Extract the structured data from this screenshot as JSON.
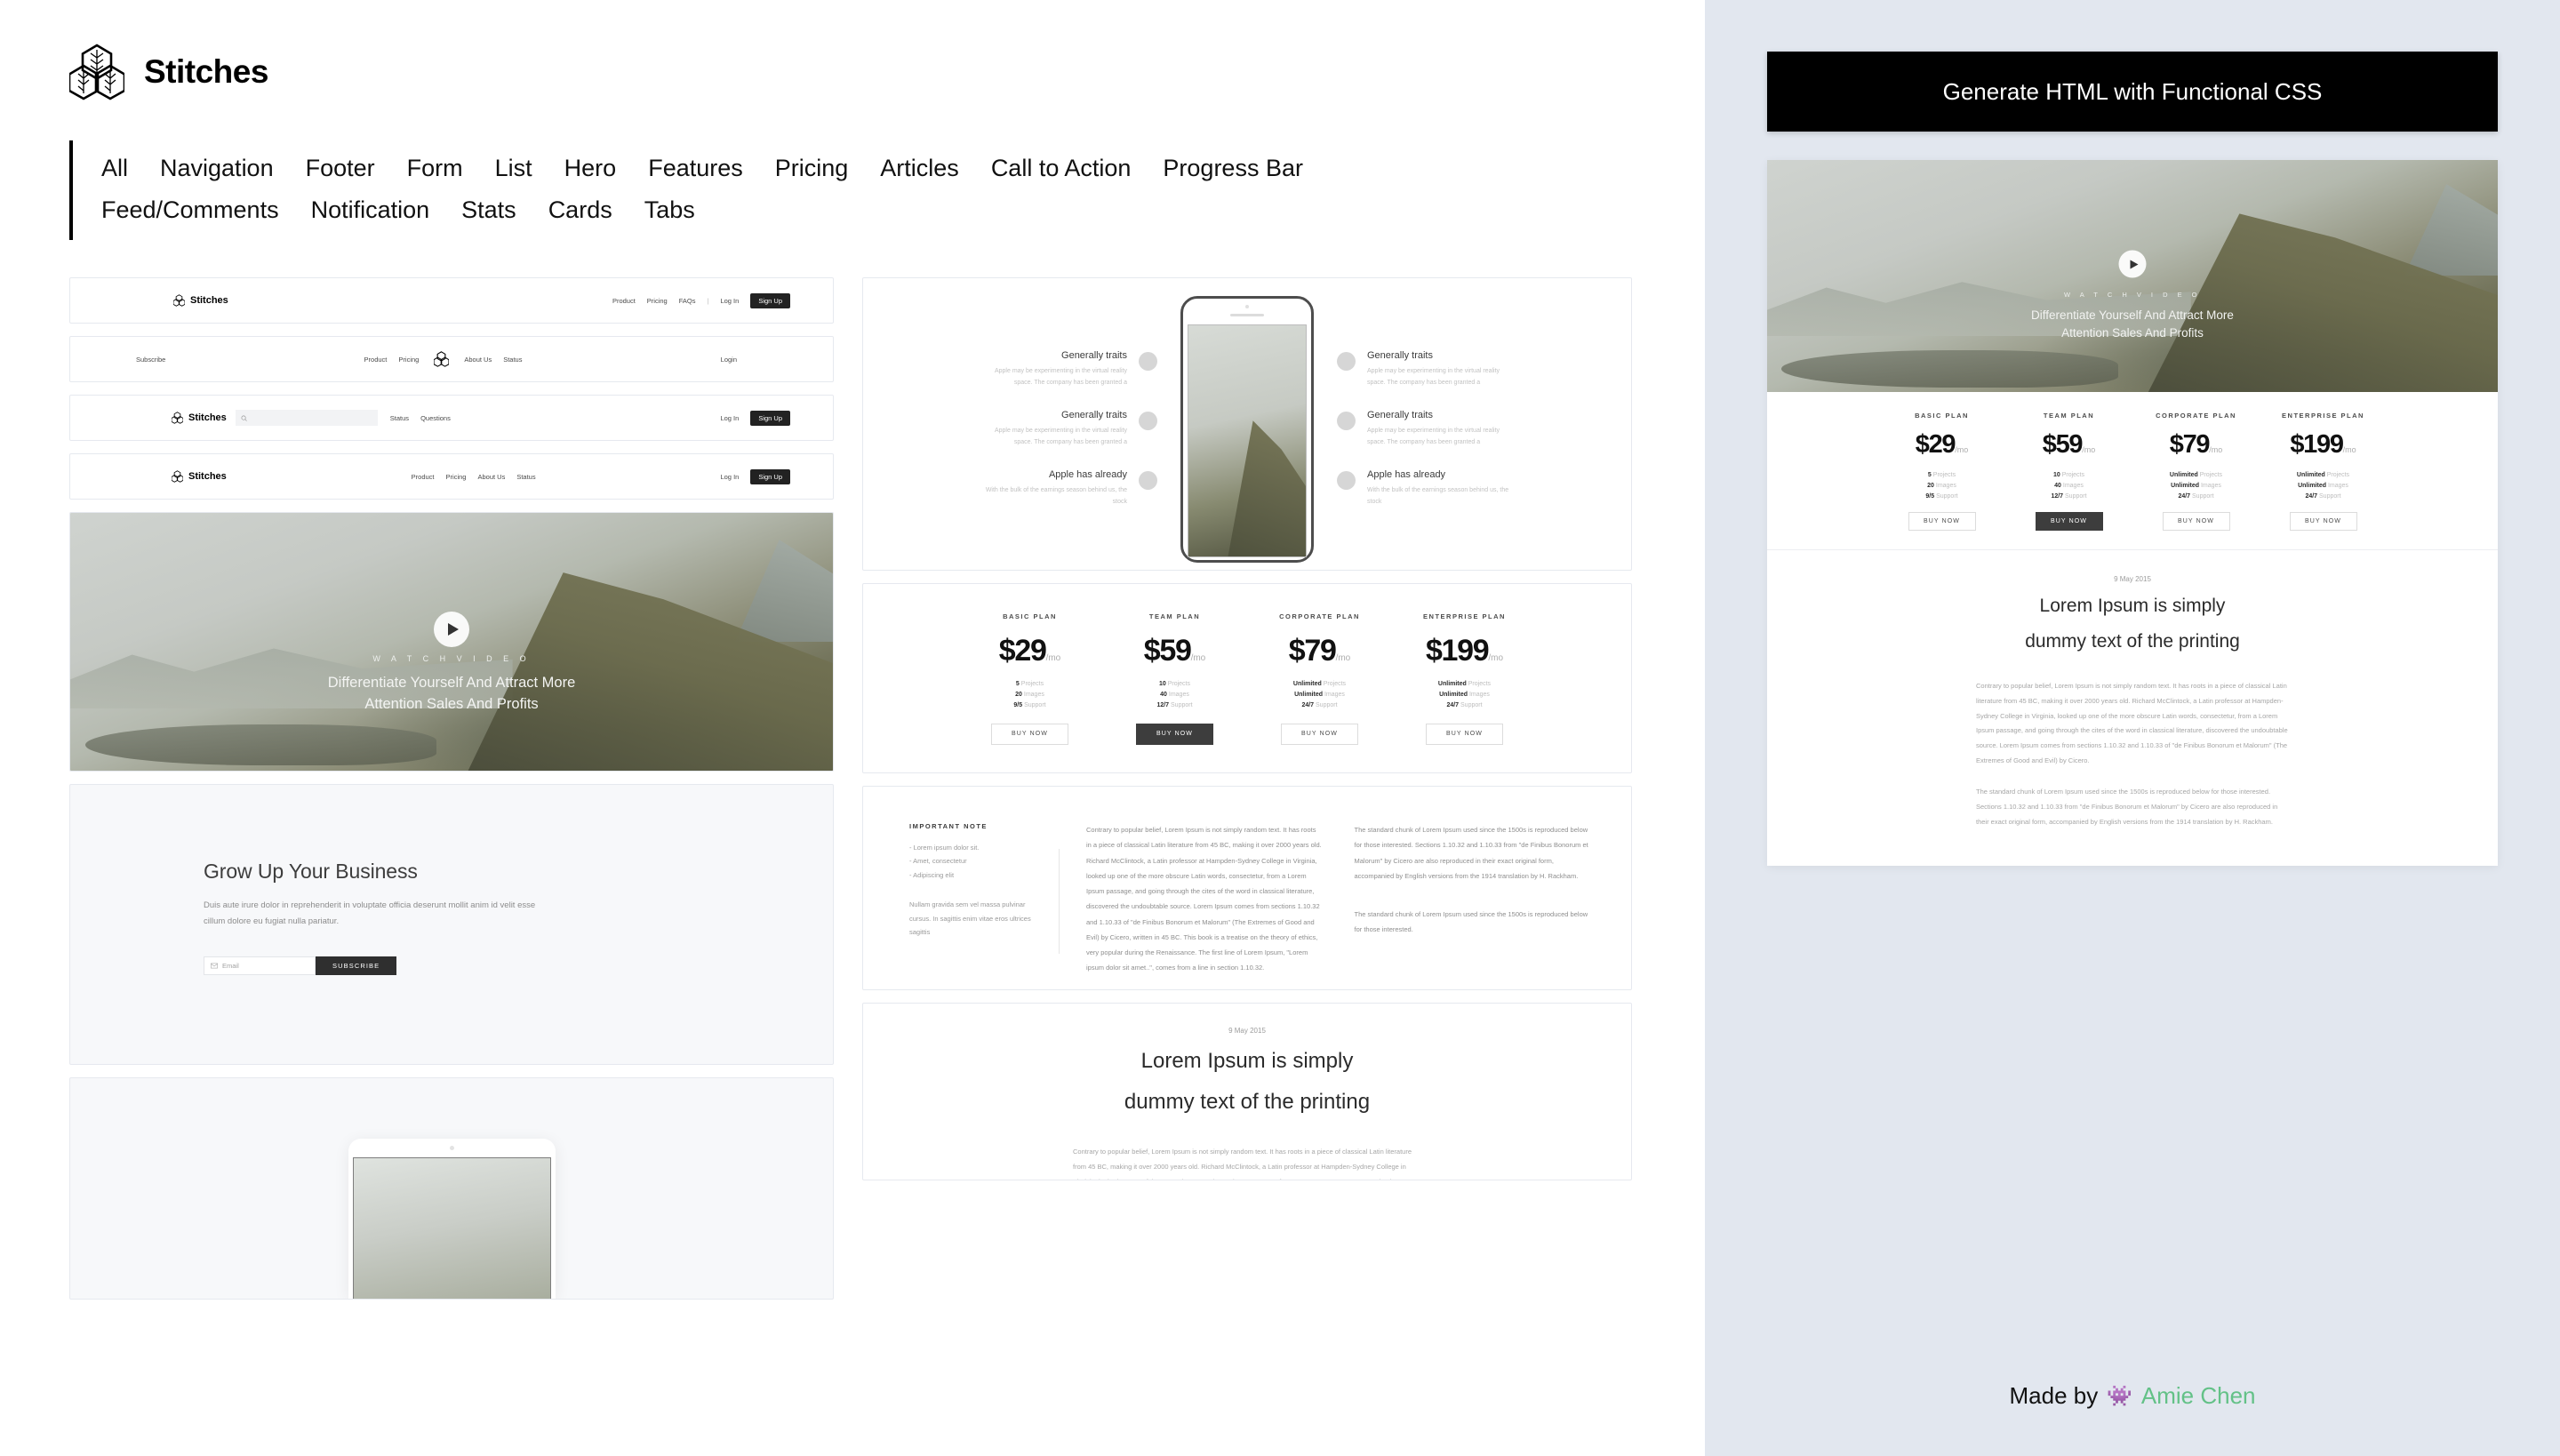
{
  "brand": {
    "name": "Stitches",
    "logo_icon": "stitches-cube-logo"
  },
  "filters": [
    "All",
    "Navigation",
    "Footer",
    "Form",
    "List",
    "Hero",
    "Features",
    "Pricing",
    "Articles",
    "Call to Action",
    "Progress Bar",
    "Feed/Comments",
    "Notification",
    "Stats",
    "Cards",
    "Tabs"
  ],
  "navbars": [
    {
      "logo": "Stitches",
      "links": [
        "Product",
        "Pricing",
        "FAQs"
      ],
      "divider": "|",
      "login": "Log In",
      "signup": "Sign Up",
      "has_search": false,
      "variant": "logo-left"
    },
    {
      "subscribe": "Subscribe",
      "links": [
        "Product",
        "Pricing"
      ],
      "links_right": [
        "About Us",
        "Status"
      ],
      "login": "Login",
      "variant": "center-logo"
    },
    {
      "logo": "Stitches",
      "search_placeholder": "",
      "search_icon": "search-icon",
      "links": [
        "Status",
        "Questions"
      ],
      "login": "Log In",
      "signup": "Sign Up",
      "has_search": true,
      "variant": "with-search"
    },
    {
      "logo": "Stitches",
      "links": [
        "Product",
        "Pricing",
        "About Us",
        "Status"
      ],
      "login": "Log In",
      "signup": "Sign Up",
      "has_search": false,
      "variant": "links-center"
    }
  ],
  "hero": {
    "kicker": "W A T C H   V I D E O",
    "title_line1": "Differentiate Yourself And Attract More",
    "title_line2": "Attention Sales And Profits",
    "play_icon": "play-icon"
  },
  "cta": {
    "heading": "Grow Up Your Business",
    "body": "Duis aute irure dolor in reprehenderit in voluptate officia deserunt mollit anim id velit esse cillum dolore eu fugiat nulla pariatur.",
    "email_placeholder": "Email",
    "email_icon": "envelope-icon",
    "subscribe_label": "SUBSCRIBE"
  },
  "features": {
    "left": [
      {
        "title": "Generally traits",
        "body": "Apple may be experimenting in the virtual reality space. The company has been granted a"
      },
      {
        "title": "Generally traits",
        "body": "Apple may be experimenting in the virtual reality space. The company has been granted a"
      },
      {
        "title": "Apple has already",
        "body": "With the bulk of the earnings season behind us, the stock"
      }
    ],
    "right": [
      {
        "title": "Generally traits",
        "body": "Apple may be experimenting in the virtual reality space. The company has been granted a"
      },
      {
        "title": "Generally traits",
        "body": "Apple may be experimenting in the virtual reality space. The company has been granted a"
      },
      {
        "title": "Apple has already",
        "body": "With the bulk of the earnings season behind us, the stock"
      }
    ]
  },
  "pricing": {
    "plans": [
      {
        "name": "BASIC PLAN",
        "price": "$29",
        "per": "/mo",
        "features": [
          {
            "value": "5",
            "label": "Projects"
          },
          {
            "value": "20",
            "label": "Images"
          },
          {
            "value": "9/5",
            "label": "Support"
          }
        ],
        "button": "BUY NOW",
        "highlighted": false
      },
      {
        "name": "TEAM PLAN",
        "price": "$59",
        "per": "/mo",
        "features": [
          {
            "value": "10",
            "label": "Projects"
          },
          {
            "value": "40",
            "label": "Images"
          },
          {
            "value": "12/7",
            "label": "Support"
          }
        ],
        "button": "BUY NOW",
        "highlighted": true
      },
      {
        "name": "CORPORATE PLAN",
        "price": "$79",
        "per": "/mo",
        "features": [
          {
            "value": "Unlimited",
            "label": "Projects"
          },
          {
            "value": "Unlimited",
            "label": "Images"
          },
          {
            "value": "24/7",
            "label": "Support"
          }
        ],
        "button": "BUY NOW",
        "highlighted": false
      },
      {
        "name": "ENTERPRISE PLAN",
        "price": "$199",
        "per": "/mo",
        "features": [
          {
            "value": "Unlimited",
            "label": "Projects"
          },
          {
            "value": "Unlimited",
            "label": "Images"
          },
          {
            "value": "24/7",
            "label": "Support"
          }
        ],
        "button": "BUY NOW",
        "highlighted": false
      }
    ]
  },
  "article": {
    "note_heading": "IMPORTANT NOTE",
    "note_items": [
      "- Lorem ipsum dolor sit.",
      "- Amet, consectetur",
      "- Adipiscing elit"
    ],
    "note_paragraph": "Nullam gravida sem vel massa pulvinar cursus. In sagittis enim vitae eros ultrices sagittis",
    "col1": "Contrary to popular belief, Lorem Ipsum is not simply random text. It has roots in a piece of classical Latin literature from 45 BC, making it over 2000 years old. Richard McClintock, a Latin professor at Hampden-Sydney College in Virginia, looked up one of the more obscure Latin words, consectetur, from a Lorem Ipsum passage, and going through the cites of the word in classical literature, discovered the undoubtable source. Lorem Ipsum comes from sections 1.10.32 and 1.10.33 of \"de Finibus Bonorum et Malorum\" (The Extremes of Good and Evil) by Cicero, written in 45 BC. This book is a treatise on the theory of ethics, very popular during the Renaissance. The first line of Lorem Ipsum, \"Lorem ipsum dolor sit amet..\", comes from a line in section 1.10.32.",
    "col2a": "The standard chunk of Lorem Ipsum used since the 1500s is reproduced below for those interested. Sections 1.10.32 and 1.10.33 from \"de Finibus Bonorum et Malorum\" by Cicero are also reproduced in their exact original form, accompanied by English versions from the 1914 translation by H. Rackham.",
    "col2b": "The standard chunk of Lorem Ipsum used since the 1500s is reproduced below for those interested."
  },
  "post": {
    "date": "9 May 2015",
    "title_line1": "Lorem Ipsum is simply",
    "title_line2": "dummy text of the printing",
    "body": "Contrary to popular belief, Lorem Ipsum is not simply random text. It has roots in a piece of classical Latin literature from 45 BC, making it over 2000 years old. Richard McClintock, a Latin professor at Hampden-Sydney College in Virginia, looked up one of the more obscure Latin words, consectetur, from a Lorem Ipsum passage, and going through the cites of the word in classical literature, discovered the undoubtable source. Lorem Ipsum comes from sections 1.10.32 and 1.10.33 of \"de Finibus Bonorum et Malorum\" (The Extremes of Good and Evil) by Cicero.",
    "body2": "The standard chunk of Lorem Ipsum used since the 1500s is reproduced below for those interested. Sections 1.10.32 and 1.10.33 from \"de Finibus Bonorum et Malorum\" by Cicero are also reproduced in their exact original form, accompanied by English versions from the 1914 translation by H. Rackham."
  },
  "right_panel": {
    "banner_label": "Generate HTML with Functional CSS",
    "made_by_prefix": "Made by",
    "made_by_icon": "alien-monster-icon",
    "made_by_name": "Amie Chen"
  },
  "colors": {
    "panel_bg": "#e2e7ef",
    "banner_bg": "#000000",
    "accent_green": "#63c187",
    "dark_button": "#3d3d3d"
  }
}
